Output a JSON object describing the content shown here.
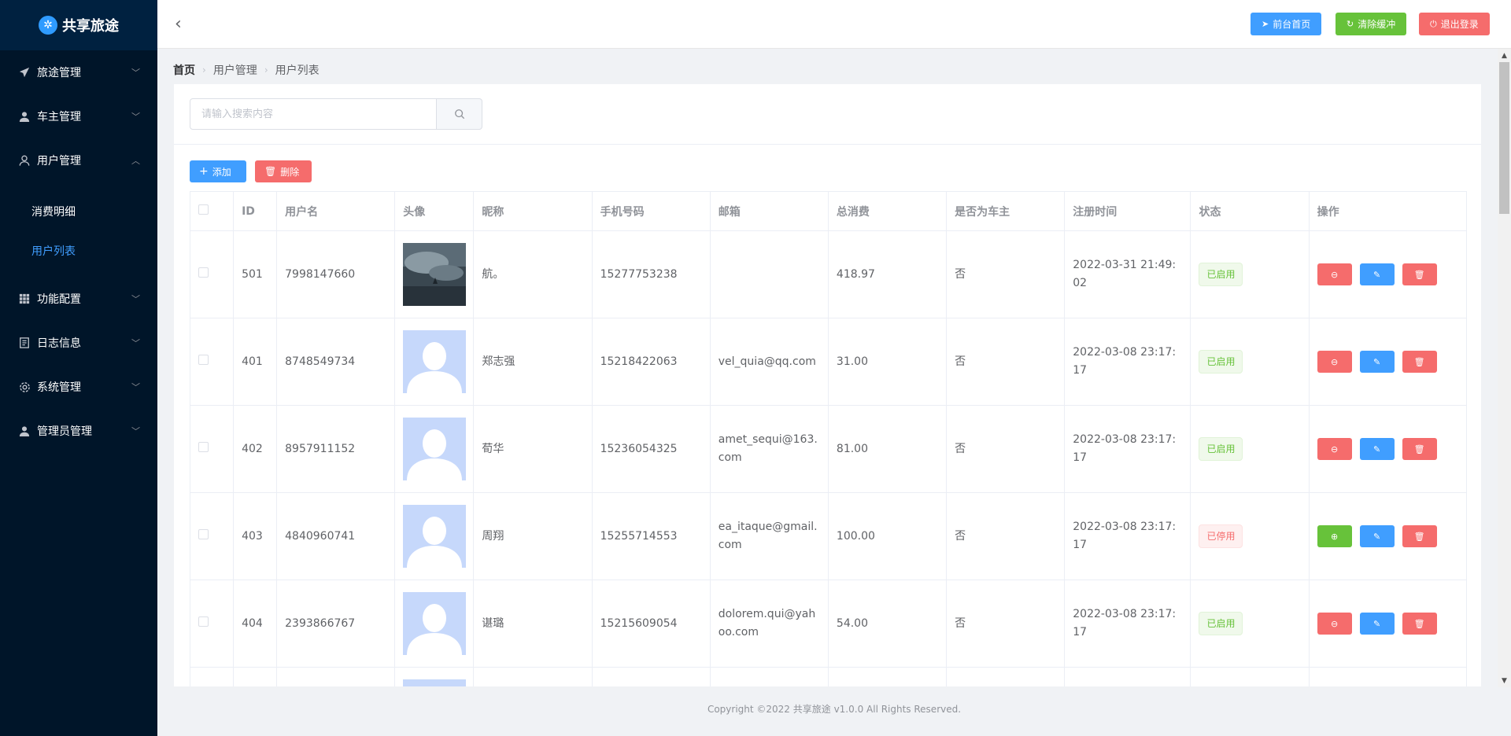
{
  "sidebar": {
    "logo": "共享旅途",
    "items": [
      {
        "label": "旅途管理",
        "name": "trips"
      },
      {
        "label": "车主管理",
        "name": "drivers"
      },
      {
        "label": "用户管理",
        "name": "users"
      },
      {
        "label": "功能配置",
        "name": "features"
      },
      {
        "label": "日志信息",
        "name": "logs"
      },
      {
        "label": "系统管理",
        "name": "system"
      },
      {
        "label": "管理员管理",
        "name": "admins"
      }
    ],
    "submenu": [
      "消费明细",
      "用户列表"
    ]
  },
  "header": {
    "btn_home": "前台首页",
    "btn_clear": "清除缓冲",
    "btn_logout": "退出登录"
  },
  "breadcrumb": [
    "首页",
    "用户管理",
    "用户列表"
  ],
  "search": {
    "placeholder": "请输入搜索内容"
  },
  "actions": {
    "add": "添加",
    "delete": "删除"
  },
  "table": {
    "headers": [
      "ID",
      "用户名",
      "头像",
      "昵称",
      "手机号码",
      "邮箱",
      "总消费",
      "是否为车主",
      "注册时间",
      "状态",
      "操作"
    ],
    "rows": [
      {
        "id": "501",
        "username": "7998147660",
        "nickname": "航。",
        "phone": "15277753238",
        "email": "",
        "spend": "418.97",
        "owner": "否",
        "time": "2022-03-31 21:49:02",
        "status": "已启用"
      },
      {
        "id": "401",
        "username": "8748549734",
        "nickname": "郑志强",
        "phone": "15218422063",
        "email": "vel_quia@qq.com",
        "spend": "31.00",
        "owner": "否",
        "time": "2022-03-08 23:17:17",
        "status": "已启用"
      },
      {
        "id": "402",
        "username": "8957911152",
        "nickname": "荀华",
        "phone": "15236054325",
        "email": "amet_sequi@163.com",
        "spend": "81.00",
        "owner": "否",
        "time": "2022-03-08 23:17:17",
        "status": "已启用"
      },
      {
        "id": "403",
        "username": "4840960741",
        "nickname": "周翔",
        "phone": "15255714553",
        "email": "ea_itaque@gmail.com",
        "spend": "100.00",
        "owner": "否",
        "time": "2022-03-08 23:17:17",
        "status": "已停用"
      },
      {
        "id": "404",
        "username": "2393866767",
        "nickname": "谌璐",
        "phone": "15215609054",
        "email": "dolorem.qui@yahoo.com",
        "spend": "54.00",
        "owner": "否",
        "time": "2022-03-08 23:17:17",
        "status": "已启用"
      }
    ]
  },
  "footer": "Copyright ©2022 共享旅途 v1.0.0 All Rights Reserved.",
  "colors": {
    "primary": "#409eff",
    "success": "#67c23a",
    "danger": "#f56c6c",
    "sidebar": "#001529"
  }
}
